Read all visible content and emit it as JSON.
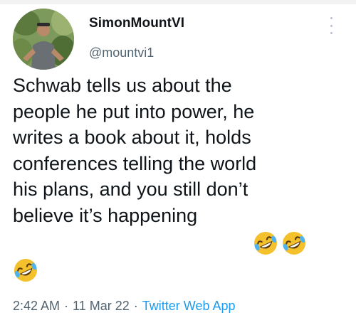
{
  "user": {
    "display_name": "SimonMountVI",
    "handle": "@mountvi1"
  },
  "tweet": {
    "text_lines": [
      "Schwab tells us about the",
      "people he put into power, he",
      "writes a book about it, holds",
      "conferences telling the world",
      "his plans, and you still don’t",
      "believe it’s happening"
    ],
    "emojis": [
      "rolling-on-floor-laughing",
      "rolling-on-floor-laughing",
      "rolling-on-floor-laughing"
    ]
  },
  "meta": {
    "time": "2:42 AM",
    "separator": "·",
    "date": "11 Mar 22",
    "source": "Twitter Web App"
  },
  "colors": {
    "text": "#0f1419",
    "secondary": "#536471",
    "link": "#1d9bf0"
  }
}
